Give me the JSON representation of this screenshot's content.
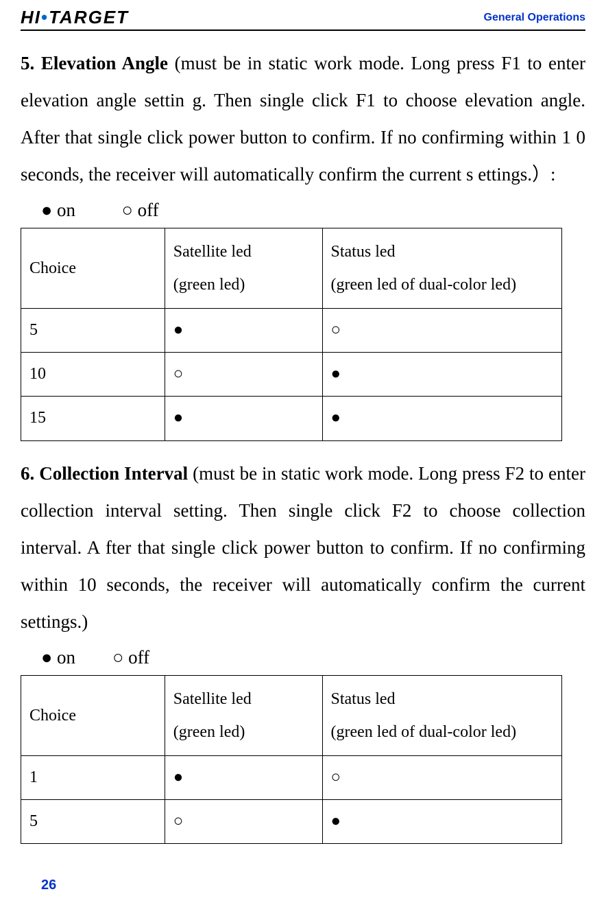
{
  "header": {
    "logo_pre": "HI",
    "logo_dot": "•",
    "logo_post": "TARGET",
    "title": "General Operations"
  },
  "section1": {
    "title": "5. Elevation Angle",
    "body": " (must be in static work mode. Long press F1 to enter elevation angle settin g. Then single click F1 to choose elevation angle. After that single click power button to confirm. If no confirming within 1 0 seconds, the receiver will automatically confirm the current s ettings.）:",
    "legend": "● on          ○ off"
  },
  "table1": {
    "h1": "Choice",
    "h2a": "Satellite led",
    "h2b": "(green led)",
    "h3a": "Status led",
    "h3b": "(green led of dual-color led)",
    "rows": [
      {
        "c": "5",
        "s": "●",
        "t": "○"
      },
      {
        "c": "10",
        "s": "○",
        "t": "●"
      },
      {
        "c": "15",
        "s": "●",
        "t": "●"
      }
    ]
  },
  "section2": {
    "title": "6. Collection Interval",
    "body": " (must be in static work mode. Long press F2 to enter collection interval setting. Then single click F2 to choose collection interval. A fter that single click power button to confirm. If no confirming within 10 seconds, the receiver will automatically confirm the current settings.)",
    "legend": "● on        ○ off"
  },
  "table2": {
    "h1": "Choice",
    "h2a": "Satellite led",
    "h2b": "(green led)",
    "h3a": "Status led",
    "h3b": "(green led of dual-color led)",
    "rows": [
      {
        "c": "1",
        "s": "●",
        "t": "○"
      },
      {
        "c": "5",
        "s": "○",
        "t": "●"
      }
    ]
  },
  "page_number": "26"
}
